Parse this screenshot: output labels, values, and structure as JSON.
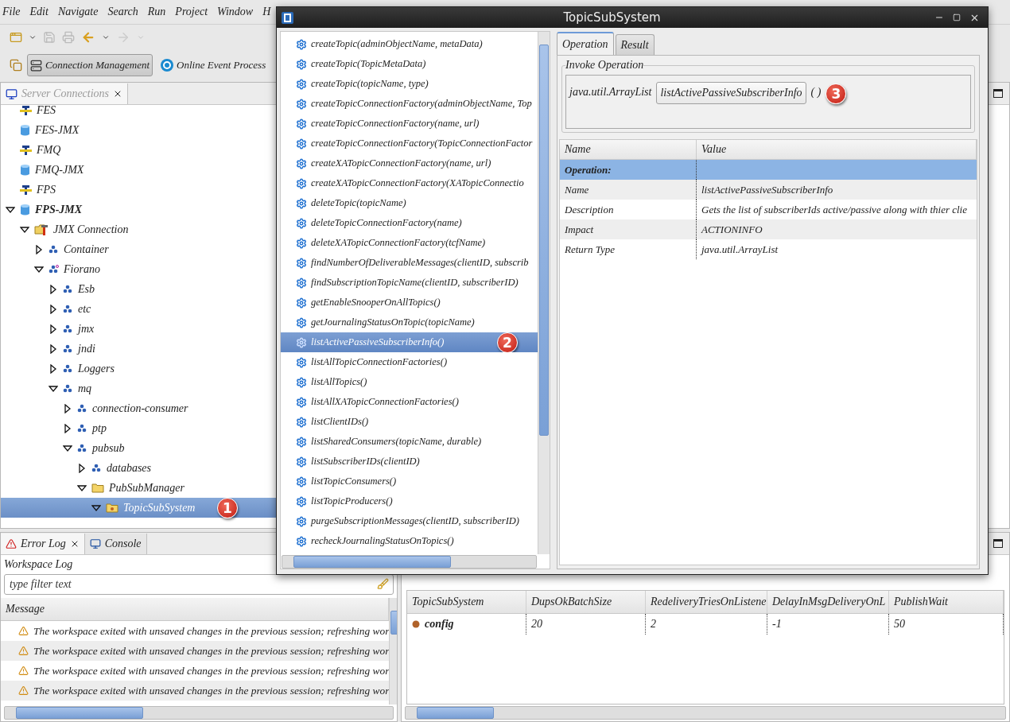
{
  "menu": [
    "File",
    "Edit",
    "Navigate",
    "Search",
    "Run",
    "Project",
    "Window",
    "H"
  ],
  "perspectives": [
    {
      "label": "Connection Management",
      "selected": true
    },
    {
      "label": "Online Event Process",
      "selected": false
    }
  ],
  "server_connections": {
    "tab": "Server Connections",
    "tree": [
      {
        "label": "FES",
        "kind": "server",
        "connected": false,
        "selected": false
      },
      {
        "label": "FES-JMX",
        "kind": "jmx",
        "connected": false,
        "selected": false
      },
      {
        "label": "FMQ",
        "kind": "server",
        "connected": false,
        "selected": false
      },
      {
        "label": "FMQ-JMX",
        "kind": "jmx",
        "connected": false,
        "selected": false
      },
      {
        "label": "FPS",
        "kind": "server",
        "connected": false,
        "selected": false
      },
      {
        "label": "FPS-JMX",
        "kind": "jmx",
        "connected": true,
        "selected": false,
        "expanded": true,
        "children": [
          {
            "label": "JMX Connection",
            "kind": "connection",
            "selected": false,
            "expanded": true,
            "children": [
              {
                "label": "Container",
                "kind": "mbean",
                "selected": false,
                "expanded": false
              },
              {
                "label": "Fiorano",
                "kind": "domain",
                "selected": false,
                "expanded": true,
                "children": [
                  {
                    "label": "Esb",
                    "kind": "mbean",
                    "selected": false,
                    "expanded": false
                  },
                  {
                    "label": "etc",
                    "kind": "mbean",
                    "selected": false,
                    "expanded": false
                  },
                  {
                    "label": "jmx",
                    "kind": "mbean",
                    "selected": false,
                    "expanded": false
                  },
                  {
                    "label": "jndi",
                    "kind": "mbean",
                    "selected": false,
                    "expanded": false
                  },
                  {
                    "label": "Loggers",
                    "kind": "mbean",
                    "selected": false,
                    "expanded": false
                  },
                  {
                    "label": "mq",
                    "kind": "mbean",
                    "selected": false,
                    "expanded": true,
                    "children": [
                      {
                        "label": "connection-consumer",
                        "kind": "mbean",
                        "selected": false,
                        "expanded": false
                      },
                      {
                        "label": "ptp",
                        "kind": "mbean",
                        "selected": false,
                        "expanded": false
                      },
                      {
                        "label": "pubsub",
                        "kind": "mbean",
                        "selected": false,
                        "expanded": true,
                        "children": [
                          {
                            "label": "databases",
                            "kind": "mbean",
                            "selected": false,
                            "expanded": false
                          },
                          {
                            "label": "PubSubManager",
                            "kind": "folder",
                            "selected": false,
                            "expanded": true,
                            "children": [
                              {
                                "label": "TopicSubSystem",
                                "kind": "object",
                                "selected": true,
                                "expanded": true
                              }
                            ]
                          }
                        ]
                      }
                    ]
                  }
                ]
              }
            ]
          }
        ]
      }
    ]
  },
  "error_log": {
    "tabs": [
      {
        "label": "Error Log",
        "selected": true
      },
      {
        "label": "Console",
        "selected": false
      }
    ],
    "title": "Workspace Log",
    "filter": {
      "placeholder": "type filter text"
    },
    "column": "Message",
    "rows": [
      "The workspace exited with unsaved changes in the previous session; refreshing wor",
      "The workspace exited with unsaved changes in the previous session; refreshing wor",
      "The workspace exited with unsaved changes in the previous session; refreshing wor",
      "The workspace exited with unsaved changes in the previous session; refreshing wor"
    ]
  },
  "attributes_table": {
    "columns": [
      "TopicSubSystem",
      "DupsOkBatchSize",
      "RedeliveryTriesOnListene",
      "DelayInMsgDeliveryOnL",
      "PublishWait"
    ],
    "rows": [
      [
        "config",
        "20",
        "2",
        "-1",
        "50"
      ]
    ]
  },
  "dialog": {
    "title": "TopicSubSystem",
    "operations": [
      {
        "label": "createTopic(adminObjectName, metaData)",
        "selected": false
      },
      {
        "label": "createTopic(TopicMetaData)",
        "selected": false
      },
      {
        "label": "createTopic(topicName, type)",
        "selected": false
      },
      {
        "label": "createTopicConnectionFactory(adminObjectName, Top",
        "selected": false
      },
      {
        "label": "createTopicConnectionFactory(name, url)",
        "selected": false
      },
      {
        "label": "createTopicConnectionFactory(TopicConnectionFactor",
        "selected": false
      },
      {
        "label": "createXATopicConnectionFactory(name, url)",
        "selected": false
      },
      {
        "label": "createXATopicConnectionFactory(XATopicConnectio",
        "selected": false
      },
      {
        "label": "deleteTopic(topicName)",
        "selected": false
      },
      {
        "label": "deleteTopicConnectionFactory(name)",
        "selected": false
      },
      {
        "label": "deleteXATopicConnectionFactory(tcfName)",
        "selected": false
      },
      {
        "label": "findNumberOfDeliverableMessages(clientID, subscrib",
        "selected": false
      },
      {
        "label": "findSubscriptionTopicName(clientID, subscriberID)",
        "selected": false
      },
      {
        "label": "getEnableSnooperOnAllTopics()",
        "selected": false
      },
      {
        "label": "getJournalingStatusOnTopic(topicName)",
        "selected": false
      },
      {
        "label": "listActivePassiveSubscriberInfo()",
        "selected": true
      },
      {
        "label": "listAllTopicConnectionFactories()",
        "selected": false
      },
      {
        "label": "listAllTopics()",
        "selected": false
      },
      {
        "label": "listAllXATopicConnectionFactories()",
        "selected": false
      },
      {
        "label": "listClientIDs()",
        "selected": false
      },
      {
        "label": "listSharedConsumers(topicName, durable)",
        "selected": false
      },
      {
        "label": "listSubscriberIDs(clientID)",
        "selected": false
      },
      {
        "label": "listTopicConsumers()",
        "selected": false
      },
      {
        "label": "listTopicProducers()",
        "selected": false
      },
      {
        "label": "purgeSubscriptionMessages(clientID, subscriberID)",
        "selected": false
      },
      {
        "label": "recheckJournalingStatusOnTopics()",
        "selected": false
      }
    ],
    "tabs": [
      {
        "label": "Operation",
        "selected": true
      },
      {
        "label": "Result",
        "selected": false
      }
    ],
    "group_title": "Invoke Operation",
    "return_type": "java.util.ArrayList",
    "invoke_button": "listActivePassiveSubscriberInfo",
    "parens": "( )",
    "info_table": {
      "columns": [
        "Name",
        "Value"
      ],
      "rows": [
        {
          "kind": "section",
          "name": "Operation:"
        },
        {
          "kind": "property",
          "name": "Name",
          "value": "listActivePassiveSubscriberInfo"
        },
        {
          "kind": "property",
          "name": "Description",
          "value": "Gets the list of subscriberIds active/passive along with thier clie"
        },
        {
          "kind": "property",
          "name": "Impact",
          "value": "ACTIONINFO"
        },
        {
          "kind": "property",
          "name": "Return Type",
          "value": "java.util.ArrayList"
        }
      ]
    }
  },
  "annotations": [
    "1",
    "2",
    "3"
  ]
}
